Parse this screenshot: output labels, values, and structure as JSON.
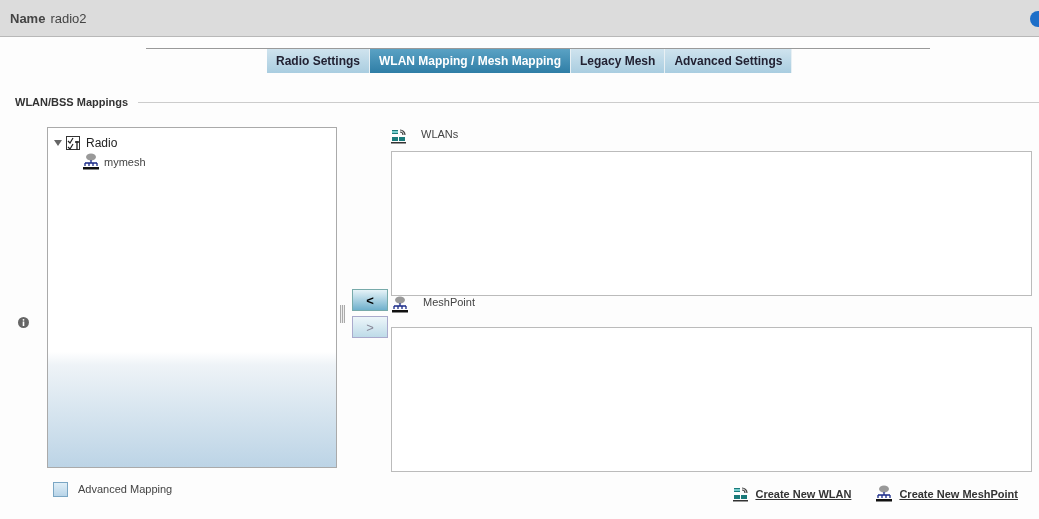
{
  "header": {
    "label": "Name",
    "value": "radio2"
  },
  "tabs": [
    {
      "label": "Radio Settings",
      "selected": false
    },
    {
      "label": "WLAN Mapping / Mesh Mapping",
      "selected": true
    },
    {
      "label": "Legacy Mesh",
      "selected": false
    },
    {
      "label": "Advanced Settings",
      "selected": false
    }
  ],
  "section": {
    "title": "WLAN/BSS Mappings"
  },
  "tree": [
    {
      "label": "Radio",
      "kind": "radio",
      "expanded": true,
      "children": [
        {
          "label": "mymesh",
          "kind": "mesh"
        }
      ]
    }
  ],
  "move_buttons": [
    {
      "label": "<",
      "disabled": false
    },
    {
      "label": ">",
      "disabled": true
    }
  ],
  "lists": [
    {
      "title": "WLANs",
      "kind": "wlan"
    },
    {
      "title": "MeshPoint",
      "kind": "mesh"
    }
  ],
  "advanced_mapping": {
    "label": "Advanced Mapping",
    "checked": false
  },
  "links": [
    {
      "label": "Create New WLAN",
      "kind": "wlan"
    },
    {
      "label": "Create New MeshPoint",
      "kind": "mesh"
    }
  ]
}
